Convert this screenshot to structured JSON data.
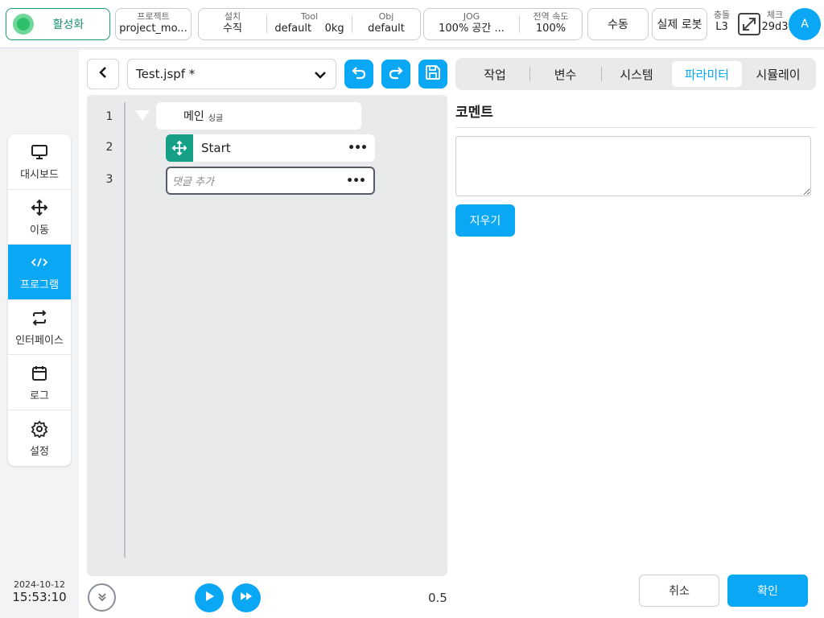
{
  "topbar": {
    "activate_label": "활성화",
    "project": {
      "title": "프로젝트",
      "value": "project_mo..."
    },
    "install": {
      "title": "설치",
      "value": "수직"
    },
    "tool": {
      "title": "Tool",
      "value": "default",
      "weight": "0kg"
    },
    "obj": {
      "title": "Obj",
      "value": "default"
    },
    "jog": {
      "title": "JOG",
      "value": "100%  공간 ..."
    },
    "global_speed": {
      "title": "전역 속도",
      "value": "100%"
    },
    "mode_label": "수동",
    "robot_label": "실제 로봇",
    "collision": {
      "title": "충돌",
      "value": "L3"
    },
    "check": {
      "title": "체크",
      "value": "29d3"
    },
    "avatar_letter": "A"
  },
  "sidebar": {
    "items": [
      {
        "label": "대시보드",
        "icon": "monitor-icon"
      },
      {
        "label": "이동",
        "icon": "move-icon"
      },
      {
        "label": "프로그램",
        "icon": "code-icon",
        "active": true
      },
      {
        "label": "인터페이스",
        "icon": "swap-icon"
      },
      {
        "label": "로그",
        "icon": "calendar-icon"
      },
      {
        "label": "설정",
        "icon": "gear-icon"
      }
    ]
  },
  "datetime": {
    "date": "2024-10-12",
    "time": "15:53:10"
  },
  "editor": {
    "file_name": "Test.jspf *",
    "lines": [
      "1",
      "2",
      "3"
    ],
    "main_node": {
      "label": "메인",
      "sub": "싱글"
    },
    "start_node": {
      "label": "Start"
    },
    "comment_node": {
      "placeholder": "댓글 추가"
    },
    "speed_value": "0.5"
  },
  "tabs": [
    "작업",
    "변수",
    "시스템",
    "파라미터",
    "시뮬레이"
  ],
  "active_tab": "파라미터",
  "panel": {
    "title": "코멘트",
    "comment_value": "",
    "clear_label": "지우기",
    "cancel_label": "취소",
    "confirm_label": "확인"
  },
  "colors": {
    "accent": "#0aa7f5",
    "active_green": "#2fbf6b",
    "move_teal": "#16a085"
  }
}
